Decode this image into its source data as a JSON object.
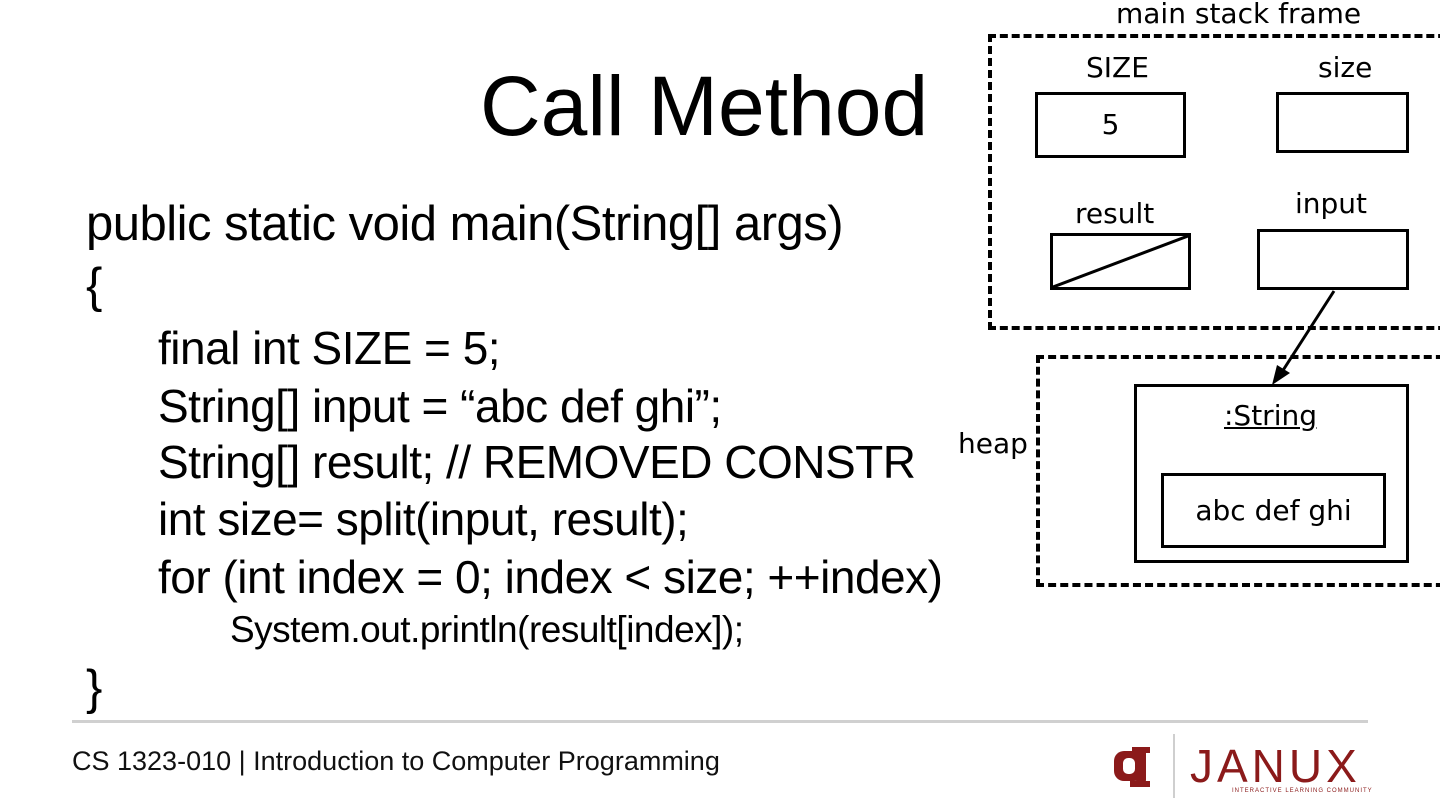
{
  "slide": {
    "title": "Call Method",
    "code_lines": [
      "public static void main(String[] args)",
      "{",
      "final int SIZE = 5;",
      "String[] input = “abc def ghi”;",
      "String[] result; // REMOVED CONSTR",
      "int size= split(input, result);",
      "for (int index = 0; index < size; ++index)",
      "System.out.println(result[index]);",
      "}"
    ]
  },
  "diagram": {
    "stack_frame_label": "main stack frame",
    "heap_label": "heap",
    "variables": {
      "size_const_label": "SIZE",
      "size_const_value": "5",
      "size_label": "size",
      "result_label": "result",
      "input_label": "input"
    },
    "heap_object": {
      "type_label": ":String",
      "value": "abc def ghi"
    }
  },
  "footer": {
    "course": "CS 1323-010 | Introduction to Computer Programming",
    "brand": "JANUX",
    "brand_tagline": "INTERACTIVE LEARNING COMMUNITY"
  },
  "colors": {
    "brand": "#8b1a1a",
    "rule": "#d0d0d0"
  }
}
